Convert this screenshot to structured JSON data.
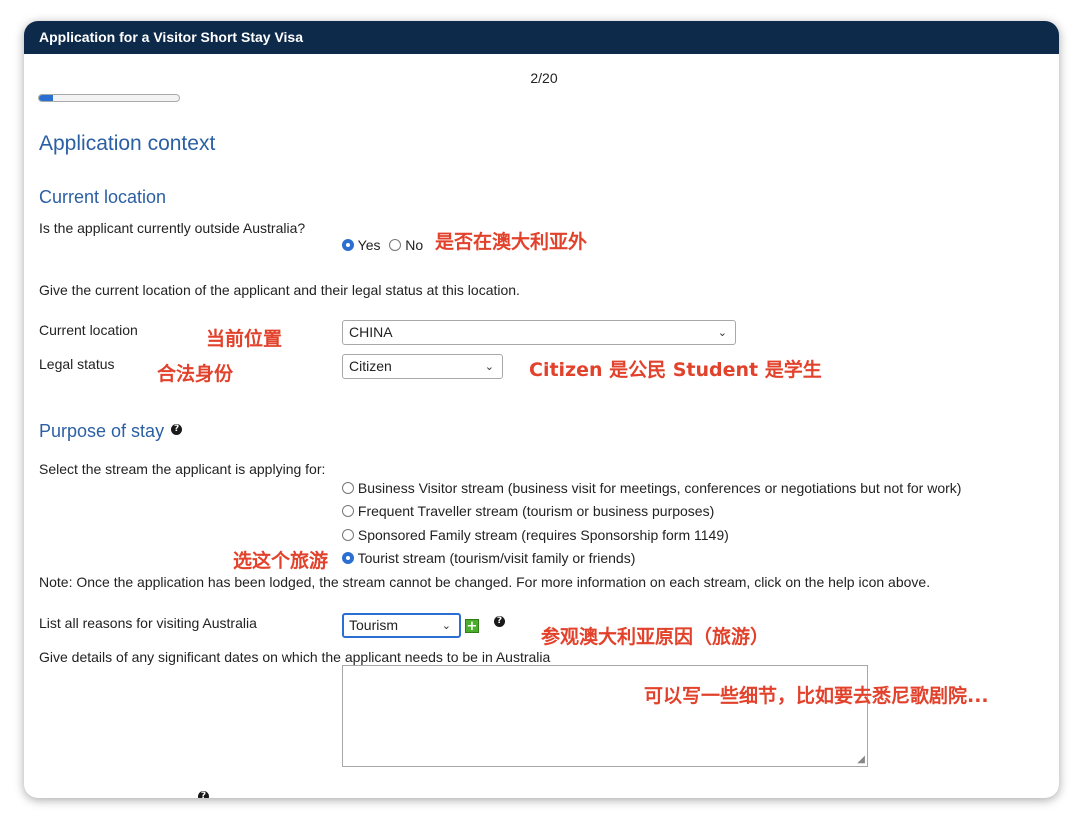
{
  "window": {
    "title": "Application for a Visitor Short Stay Visa"
  },
  "progress": {
    "step_text": "2/20",
    "fraction": 0.1
  },
  "page_title": "Application context",
  "current_location_section": {
    "heading": "Current location",
    "outside_question": "Is the applicant currently outside Australia?",
    "yes_label": "Yes",
    "no_label": "No",
    "selected": "Yes",
    "annotation_outside": "是否在澳大利亚外",
    "give_location_text": "Give the current location of the applicant and their legal status at this location.",
    "location_label": "Current location",
    "location_annotation": "当前位置",
    "location_value": "CHINA",
    "legal_status_label": "Legal status",
    "legal_status_annotation": "合法身份",
    "legal_status_value": "Citizen",
    "legal_status_note": "Citizen 是公民 Student 是学生"
  },
  "purpose_section": {
    "heading": "Purpose of stay",
    "select_stream_text": "Select the stream the applicant is applying for:",
    "streams": [
      {
        "label": "Business Visitor stream (business visit for meetings, conferences or negotiations but not for work)",
        "checked": false
      },
      {
        "label": "Frequent Traveller stream (tourism or business purposes)",
        "checked": false
      },
      {
        "label": "Sponsored Family stream (requires Sponsorship form 1149)",
        "checked": false
      },
      {
        "label": "Tourist stream (tourism/visit family or friends)",
        "checked": true
      }
    ],
    "tourist_annotation": "选这个旅游",
    "note": "Note: Once the application has been lodged, the stream cannot be changed. For more information on each stream, click on the help icon above.",
    "reasons_label": "List all reasons for visiting Australia",
    "reasons_value": "Tourism",
    "reasons_annotation": "参观澳大利亚原因（旅游）",
    "dates_label": "Give details of any significant dates on which the applicant needs to be in Australia",
    "dates_annotation": "可以写一些细节，比如要去悉尼歌剧院..."
  },
  "icons": {
    "help": "help-icon",
    "chevron": "chevron-down-icon",
    "plus": "plus-icon"
  },
  "colors": {
    "titlebar": "#0e2a4b",
    "heading": "#2b5fa3",
    "annotation": "#e2422b",
    "accent": "#2a6fd1",
    "add_button": "#4caf2c"
  }
}
